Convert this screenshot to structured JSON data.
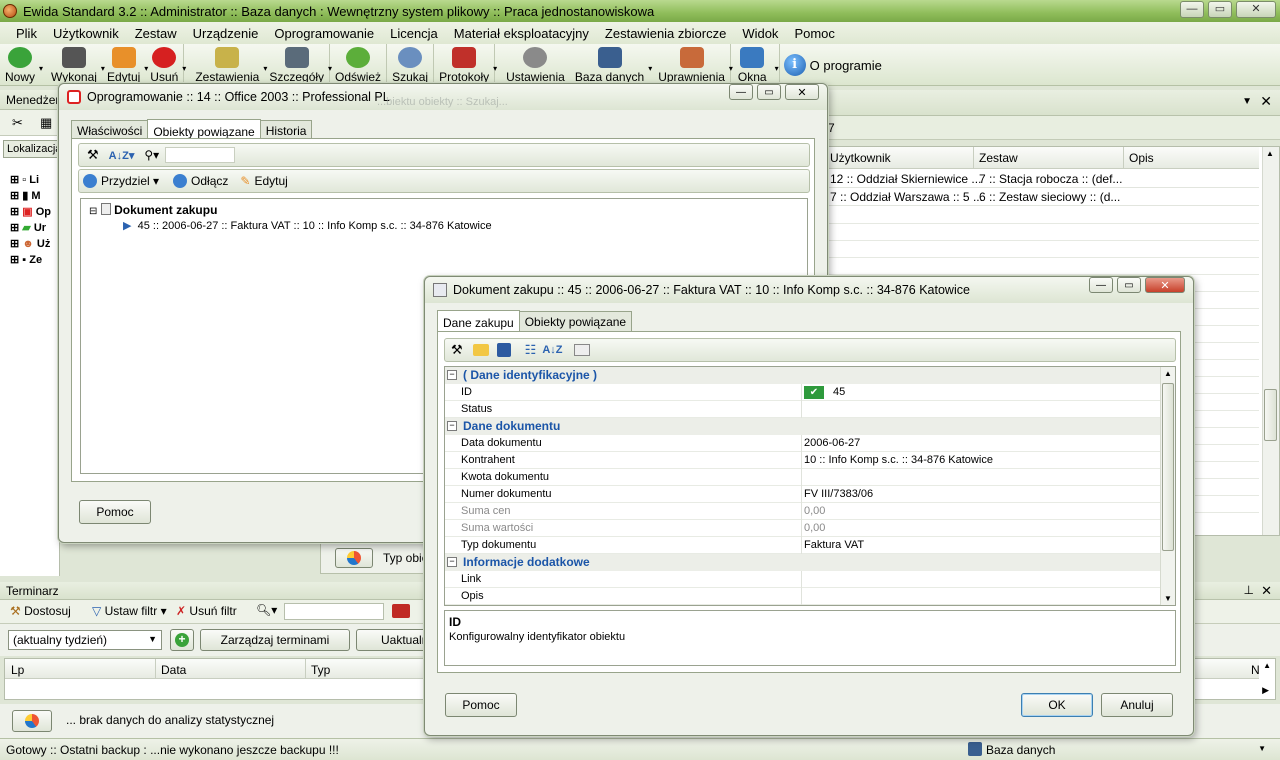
{
  "app": {
    "title": "Ewida Standard 3.2  ::  Administrator  ::  Baza danych : Wewnętrzny system plikowy  ::  Praca jednostanowiskowa",
    "win_min": "—",
    "win_max": "▭",
    "win_close": "✕"
  },
  "menu": [
    "Plik",
    "Użytkownik",
    "Zestaw",
    "Urządzenie",
    "Oprogramowanie",
    "Licencja",
    "Materiał eksploatacyjny",
    "Zestawienia zbiorcze",
    "Widok",
    "Pomoc"
  ],
  "toolbar": [
    {
      "label": "Nowy",
      "color": "#3aa33a"
    },
    {
      "label": "Wykonaj",
      "color": "#555555"
    },
    {
      "label": "Edytuj",
      "color": "#e8902a"
    },
    {
      "label": "Usuń",
      "color": "#d62020"
    },
    {
      "label": "Zestawienia",
      "color": "#c8b24a"
    },
    {
      "label": "Szczegóły",
      "color": "#5a6b7a"
    },
    {
      "label": "Odśwież",
      "color": "#5cae3a"
    },
    {
      "label": "Szukaj",
      "color": "#6a8fbf"
    },
    {
      "label": "Protokoły",
      "color": "#c0302a"
    },
    {
      "label": "Ustawienia",
      "color": "#8a8a8a"
    },
    {
      "label": "Baza danych",
      "color": "#3a5f8f"
    },
    {
      "label": "Uprawnienia",
      "color": "#c86a3a"
    },
    {
      "label": "Okna",
      "color": "#3a7ac0"
    }
  ],
  "about_label": "O programie",
  "left_panel": {
    "title": "Menedżer",
    "location_tab": "Lokalizacja",
    "tree": [
      "Li",
      "M",
      "Op",
      "Ur",
      "Uż",
      "Ze"
    ]
  },
  "right_grid": {
    "header_partial": "7",
    "columns": [
      "Użytkownik",
      "Zestaw",
      "Opis"
    ],
    "rows": [
      [
        "12 :: Oddział Skierniewice ...",
        "7 :: Stacja robocza :: (def...",
        ""
      ],
      [
        "7 :: Oddział Warszawa :: 5 ...",
        "6 :: Zestaw sieciowy :: (d...",
        ""
      ]
    ]
  },
  "typ_button": "Typ obie",
  "terminarz": {
    "title": "Terminarz",
    "dostosuj": "Dostosuj",
    "ustaw_filtr": "Ustaw filtr",
    "usun_filtr": "Usuń filtr",
    "period": "(aktualny tydzień)",
    "manage": "Zarządzaj terminami",
    "update": "Uaktualni",
    "columns": [
      "Lp",
      "Data",
      "Typ"
    ],
    "col_n": "N",
    "stat": "... brak danych do analizy statystycznej"
  },
  "status": {
    "left": "Gotowy  ::  Ostatni backup : ...nie wykonano jeszcze backupu !!!",
    "right": "Baza danych"
  },
  "dlg1": {
    "title": "Oprogramowanie :: 14 :: Office 2003 :: Professional PL",
    "tabs": [
      "Właściwości",
      "Obiekty powiązane",
      "Historia"
    ],
    "actions": [
      "Przydziel",
      "Odłącz",
      "Edytuj"
    ],
    "tree_root": "Dokument zakupu",
    "tree_child": "45 :: 2006-06-27 :: Faktura VAT :: 10 :: Info Komp s.c. :: 34-876 Katowice",
    "help": "Pomoc",
    "ghost_text": "...biektu obiekty :: Szukaj..."
  },
  "dlg2": {
    "title": "Dokument zakupu :: 45 :: 2006-06-27 :: Faktura VAT :: 10 :: Info Komp s.c. :: 34-876 Katowice",
    "tabs": [
      "Dane zakupu",
      "Obiekty powiązane"
    ],
    "cat1": "( Dane identyfikacyjne )",
    "cat2": "Dane dokumentu",
    "cat3": "Informacje dodatkowe",
    "rows": {
      "id": {
        "k": "ID",
        "v": "45"
      },
      "status": {
        "k": "Status",
        "v": ""
      },
      "data": {
        "k": "Data dokumentu",
        "v": "2006-06-27"
      },
      "kontrahent": {
        "k": "Kontrahent",
        "v": "10 :: Info Komp s.c. :: 34-876 Katowice"
      },
      "kwota": {
        "k": "Kwota dokumentu",
        "v": ""
      },
      "numer": {
        "k": "Numer dokumentu",
        "v": "FV III/7383/06"
      },
      "suma_cen": {
        "k": "Suma cen",
        "v": "0,00"
      },
      "suma_wart": {
        "k": "Suma wartości",
        "v": "0,00"
      },
      "typ": {
        "k": "Typ dokumentu",
        "v": "Faktura VAT"
      },
      "link": {
        "k": "Link",
        "v": ""
      },
      "opis": {
        "k": "Opis",
        "v": ""
      }
    },
    "help_title": "ID",
    "help_text": "Konfigurowalny identyfikator obiektu",
    "btn_help": "Pomoc",
    "btn_ok": "OK",
    "btn_cancel": "Anuluj"
  },
  "colors": {
    "accent": "#8fbd5a",
    "link_blue": "#1b55a8"
  }
}
